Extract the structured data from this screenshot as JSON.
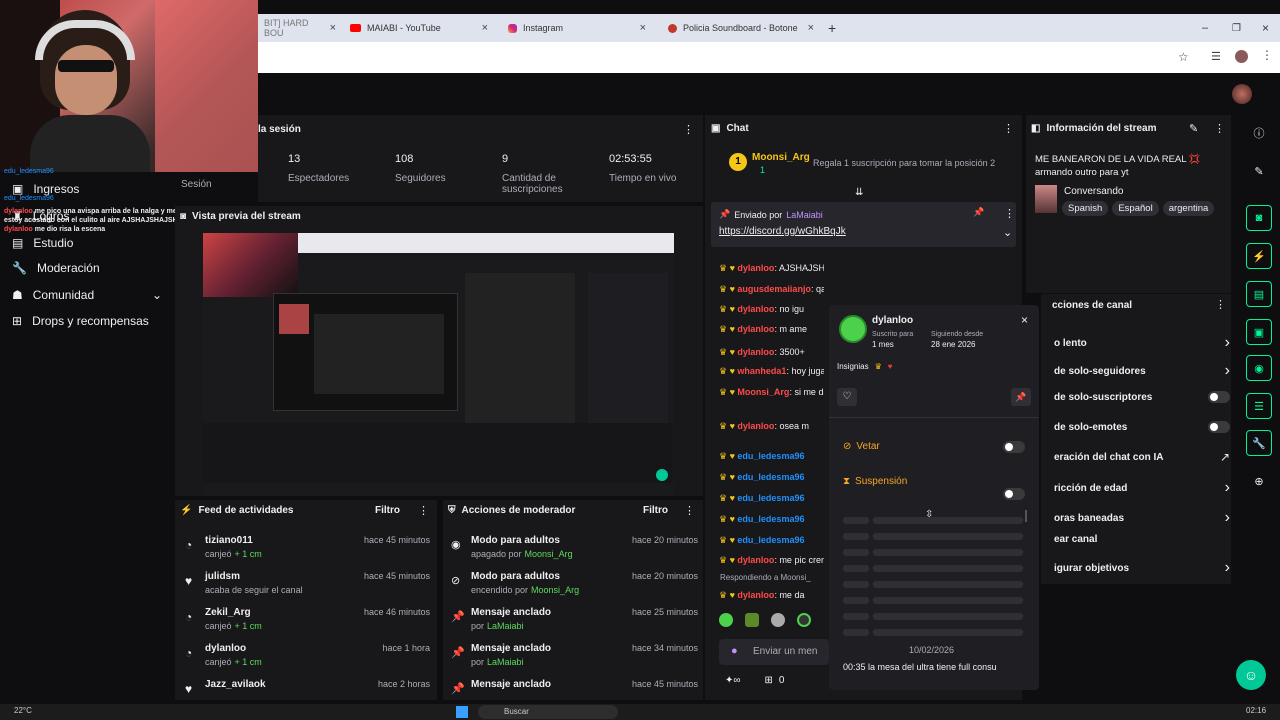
{
  "browser": {
    "tabs": [
      {
        "label": "BIT] HARD BOU"
      },
      {
        "label": "MAIABI - YouTube"
      },
      {
        "label": "Instagram"
      },
      {
        "label": "Policia Soundboard - Botones"
      }
    ],
    "new_tab": "+"
  },
  "overlay_chat": [
    {
      "user": "edu_ledesma96",
      "msg": ""
    },
    {
      "user": "edu_ledesma96",
      "msg": ""
    },
    {
      "user": "dylanloo",
      "msg": "me pico una avispa arriba de la nalga y me puse crema, estoy acostado con el culito al aire AJSHAJSHAJSHAJ"
    },
    {
      "user": "dylanloo",
      "msg": "me dio risa la escena"
    }
  ],
  "leftnav": {
    "items": [
      {
        "label": "Ingresos"
      },
      {
        "label": "Logros"
      },
      {
        "label": "Estudio"
      },
      {
        "label": "Moderación"
      },
      {
        "label": "Comunidad"
      },
      {
        "label": "Drops y recompensas"
      }
    ]
  },
  "session": {
    "title": "la sesión",
    "label": "Sesión",
    "stats": [
      {
        "value": "13",
        "label": "Espectadores"
      },
      {
        "value": "108",
        "label": "Seguidores"
      },
      {
        "value": "9",
        "label": "Cantidad de suscripciones"
      },
      {
        "value": "02:53:55",
        "label": "Tiempo en vivo"
      }
    ]
  },
  "preview": {
    "title": "Vista previa del stream"
  },
  "feed": {
    "title": "Feed de actividades",
    "filter": "Filtro",
    "items": [
      {
        "name": "tiziano011",
        "sub": "canjeó",
        "amount": "+ 1 cm",
        "time": "hace 45 minutos",
        "icon": "points-icon"
      },
      {
        "name": "julidsm",
        "sub": "acaba de seguir el canal",
        "amount": "",
        "time": "hace 45 minutos",
        "icon": "heart-icon"
      },
      {
        "name": "Zekil_Arg",
        "sub": "canjeó",
        "amount": "+ 1 cm",
        "time": "hace 46 minutos",
        "icon": "points-icon"
      },
      {
        "name": "dylanloo",
        "sub": "canjeó",
        "amount": "+ 1 cm",
        "time": "hace 1 hora",
        "icon": "points-icon"
      },
      {
        "name": "Jazz_avilaok",
        "sub": "",
        "amount": "",
        "time": "hace 2 horas",
        "icon": "heart-icon"
      }
    ]
  },
  "modactions": {
    "title": "Acciones de moderador",
    "filter": "Filtro",
    "items": [
      {
        "name": "Modo para adultos",
        "sub": "apagado por",
        "by": "Moonsi_Arg",
        "time": "hace 20 minutos",
        "icon": "eye-icon"
      },
      {
        "name": "Modo para adultos",
        "sub": "encendido por",
        "by": "Moonsi_Arg",
        "time": "hace 20 minutos",
        "icon": "eye-off-icon"
      },
      {
        "name": "Mensaje anclado",
        "sub": "por",
        "by": "LaMaiabi",
        "time": "hace 25 minutos",
        "icon": "pin-icon"
      },
      {
        "name": "Mensaje anclado",
        "sub": "por",
        "by": "LaMaiabi",
        "time": "hace 34 minutos",
        "icon": "pin-icon"
      },
      {
        "name": "Mensaje anclado",
        "sub": "",
        "by": "",
        "time": "hace 45 minutos",
        "icon": "pin-icon"
      }
    ]
  },
  "chat": {
    "title": "Chat",
    "gift": {
      "rank": "1",
      "user": "Moonsi_Arg",
      "count": "1",
      "text": "Regala 1 suscripción para tomar la posición 2"
    },
    "pinned": {
      "label": "Enviado por",
      "user": "LaMaiabi",
      "link": "https://discord.gg/wGhkBqJk"
    },
    "lines": [
      {
        "user": "dylanloo",
        "msg": ": AJSHAJSHAJSHAJ",
        "color": "#ff4a4a"
      },
      {
        "user": "augusdemaiianjo",
        "msg": ": qa calorrr",
        "color": "#ff4a4a"
      },
      {
        "user": "dylanloo",
        "msg": ": no igu",
        "color": "#ff4a4a"
      },
      {
        "user": "dylanloo",
        "msg": ": m ame",
        "color": "#ff4a4a"
      },
      {
        "user": "dylanloo",
        "msg": ": 3500+",
        "color": "#ff4a4a"
      },
      {
        "user": "whanheda1",
        "msg": ": hoy jugam",
        "color": "#ff4a4a"
      },
      {
        "user": "Moonsi_Arg",
        "msg": ": si me da un bobazo de l",
        "color": "#ff4a4a"
      },
      {
        "user": "dylanloo",
        "msg": ": osea m",
        "color": "#ff4a4a"
      },
      {
        "user": "edu_ledesma96",
        "msg": "",
        "color": "#1e90ff"
      },
      {
        "user": "edu_ledesma96",
        "msg": "",
        "color": "#1e90ff"
      },
      {
        "user": "edu_ledesma96",
        "msg": "",
        "color": "#1e90ff"
      },
      {
        "user": "edu_ledesma96",
        "msg": "",
        "color": "#1e90ff"
      },
      {
        "user": "edu_ledesma96",
        "msg": "",
        "color": "#1e90ff"
      },
      {
        "user": "dylanloo",
        "msg": ": me pic crema, estoy acostado",
        "color": "#ff4a4a"
      },
      {
        "user": "dylanloo",
        "msg": ": me da",
        "color": "#ff4a4a"
      }
    ],
    "replying": "Respondiendo a Moonsi_",
    "input_placeholder": "Enviar un men",
    "points": "0"
  },
  "usercard": {
    "name": "dylanloo",
    "sub_label": "Suscrito para",
    "sub_value": "1 mes",
    "follow_label": "Siguiendo desde",
    "follow_value": "28 ene 2026",
    "badges_label": "Insignias",
    "veto": "Vetar",
    "timeout": "Suspensión",
    "date": "10/02/2026",
    "last_msg": "00:35 la mesa del ultra tiene full consu"
  },
  "streaminfo": {
    "title": "Información del stream",
    "stream_title": "ME BANEARON DE LA VIDA REAL 💢 armando outro para yt",
    "category": "Conversando",
    "tags": [
      "Spanish",
      "Español",
      "argentina"
    ]
  },
  "quickactions": {
    "title": "cciones de canal",
    "items": [
      {
        "label": "o lento",
        "control": "chevron"
      },
      {
        "label": "de solo-seguidores",
        "control": "chevron"
      },
      {
        "label": "de solo-suscriptores",
        "control": "toggle"
      },
      {
        "label": "de solo-emotes",
        "control": "toggle"
      },
      {
        "label": "eración del chat con IA",
        "control": "external"
      },
      {
        "label": "ricción de edad",
        "control": "chevron"
      },
      {
        "label": "oras baneadas",
        "control": "chevron"
      },
      {
        "label": "ear canal",
        "control": "none"
      },
      {
        "label": "igurar objetivos",
        "control": "chevron"
      }
    ]
  },
  "taskbar": {
    "weather": "22°C",
    "search": "Buscar",
    "time": "02:16"
  },
  "colors": {
    "accent": "#9147ff",
    "green": "#00f593",
    "bg": "#0e0e10",
    "panel": "#18181b"
  }
}
